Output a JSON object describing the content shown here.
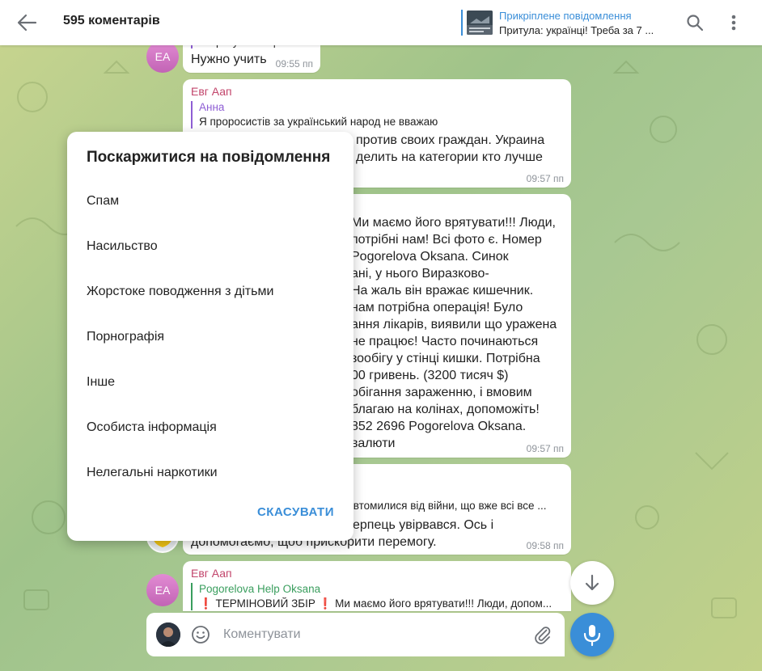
{
  "header": {
    "title": "595 коментарів",
    "pinned_title": "Прикріплене повідомлення",
    "pinned_text": "Притула: українці! Треба за 7 ..."
  },
  "messages": [
    {
      "avatar": "ЕА",
      "reply_text": "Не розуміє нацизм...",
      "text": "Нужно учить",
      "time": "09:55 пп"
    },
    {
      "author": "Евг Аап",
      "reply_name": "Анна",
      "reply_text": "Я проросистів за український народ не вважаю",
      "text_line1": "против своих граждан. Украина",
      "text_line2": "делить на категории кто лучше",
      "time": "09:57 пп"
    },
    {
      "lines": [
        "Ми маємо його врятувати!!! Люди,",
        "потрібні нам! Всі фото є. Номер",
        "Pogorelova Oksana. Синок",
        "ані, у нього Виразково-",
        " На жаль він вражає кишечник.",
        " нам потрібна операція! Було",
        "ання лікарів, виявили що уражена",
        "не працює! Часто починаються",
        "зообігу у стінці кишки. Потрібна",
        "00 гривень. (3200 тисяч $)",
        "обігання зараженню, і вмовим",
        " благаю на колінах, допоможіть!",
        "852 2696   Pogorelova Oksana.",
        "валюти"
      ],
      "time": "09:57 пп"
    },
    {
      "reply_text": "і втомилися від війни, що вже всі все ...",
      "text_line1": "ерпець увірвався. Ось і",
      "text_line2": "допомогаємо, щоб прискорити перемогу.",
      "time": "09:58 пп"
    },
    {
      "avatar": "ЕА",
      "author": "Евг Аап",
      "reply_name": "Pogorelova Help Oksana",
      "reply_text": "❗ ТЕРМІНОВИЙ ЗБІР ❗  Ми маємо його врятувати!!! Люди, допом..."
    }
  ],
  "report_dialog": {
    "title": "Поскаржитися на повідомлення",
    "options": [
      "Спам",
      "Насильство",
      "Жорстоке поводження з дітьми",
      "Порнографія",
      "Інше",
      "Особиста інформація",
      "Нелегальні наркотики"
    ],
    "cancel": "СКАСУВАТИ"
  },
  "composer": {
    "placeholder": "Коментувати"
  },
  "colors": {
    "accent": "#3a8ed8",
    "author": "#c2456b",
    "reply": "#8e5ed4"
  }
}
